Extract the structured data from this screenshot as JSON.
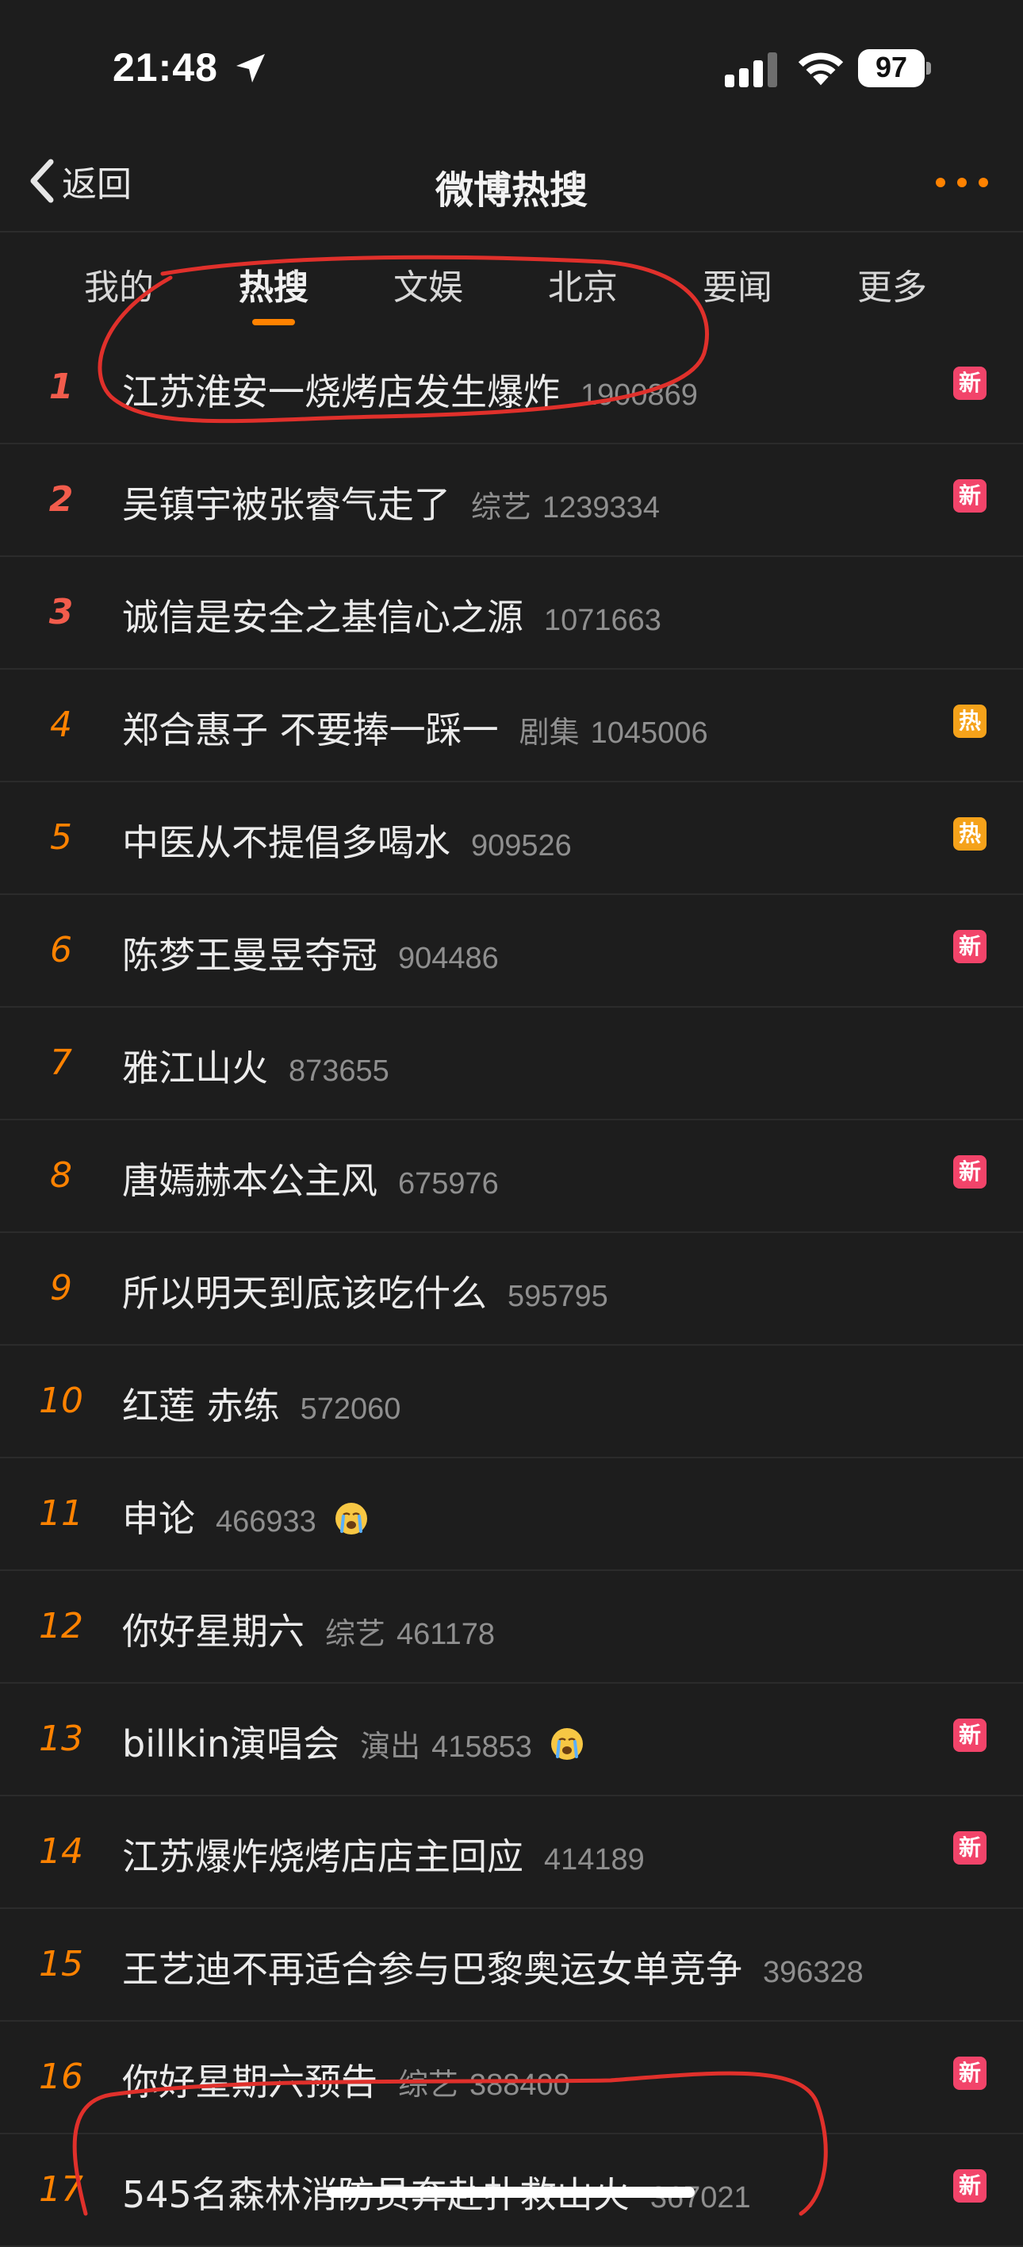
{
  "status_bar": {
    "time": "21:48",
    "battery": "97"
  },
  "navbar": {
    "back_label": "返回",
    "title": "微博热搜"
  },
  "tabs": [
    {
      "label": "我的"
    },
    {
      "label": "热搜"
    },
    {
      "label": "文娱"
    },
    {
      "label": "北京"
    },
    {
      "label": "要闻"
    },
    {
      "label": "更多"
    }
  ],
  "active_tab": "热搜",
  "colors": {
    "accent": "#ff8200",
    "badge_new": "#f2446a",
    "badge_hot": "#f5a21a",
    "annotation": "#e0302b"
  },
  "items": [
    {
      "rank": "1",
      "title": "江苏淮安一烧烤店发生爆炸",
      "category": "",
      "count": "1900869",
      "badge": "新"
    },
    {
      "rank": "2",
      "title": "吴镇宇被张睿气走了",
      "category": "综艺",
      "count": "1239334",
      "badge": "新"
    },
    {
      "rank": "3",
      "title": "诚信是安全之基信心之源",
      "category": "",
      "count": "1071663",
      "badge": ""
    },
    {
      "rank": "4",
      "title": "郑合惠子 不要捧一踩一",
      "category": "剧集",
      "count": "1045006",
      "badge": "热"
    },
    {
      "rank": "5",
      "title": "中医从不提倡多喝水",
      "category": "",
      "count": "909526",
      "badge": "热"
    },
    {
      "rank": "6",
      "title": "陈梦王曼昱夺冠",
      "category": "",
      "count": "904486",
      "badge": "新"
    },
    {
      "rank": "7",
      "title": "雅江山火",
      "category": "",
      "count": "873655",
      "badge": ""
    },
    {
      "rank": "8",
      "title": "唐嫣赫本公主风",
      "category": "",
      "count": "675976",
      "badge": "新"
    },
    {
      "rank": "9",
      "title": "所以明天到底该吃什么",
      "category": "",
      "count": "595795",
      "badge": ""
    },
    {
      "rank": "10",
      "title": "红莲 赤练",
      "category": "",
      "count": "572060",
      "badge": ""
    },
    {
      "rank": "11",
      "title": "申论",
      "category": "",
      "count": "466933",
      "badge": "",
      "emoji": "crying-face-icon"
    },
    {
      "rank": "12",
      "title": "你好星期六",
      "category": "综艺",
      "count": "461178",
      "badge": ""
    },
    {
      "rank": "13",
      "title": "billkin演唱会",
      "category": "演出",
      "count": "415853",
      "badge": "新",
      "emoji": "crying-face-icon"
    },
    {
      "rank": "14",
      "title": "江苏爆炸烧烤店店主回应",
      "category": "",
      "count": "414189",
      "badge": "新"
    },
    {
      "rank": "15",
      "title": "王艺迪不再适合参与巴黎奥运女单竞争",
      "category": "",
      "count": "396328",
      "badge": ""
    },
    {
      "rank": "16",
      "title": "你好星期六预告",
      "category": "综艺",
      "count": "388400",
      "badge": "新"
    },
    {
      "rank": "17",
      "title": "545名森林消防员奔赴扑救山火",
      "category": "",
      "count": "367021",
      "badge": "新"
    }
  ]
}
